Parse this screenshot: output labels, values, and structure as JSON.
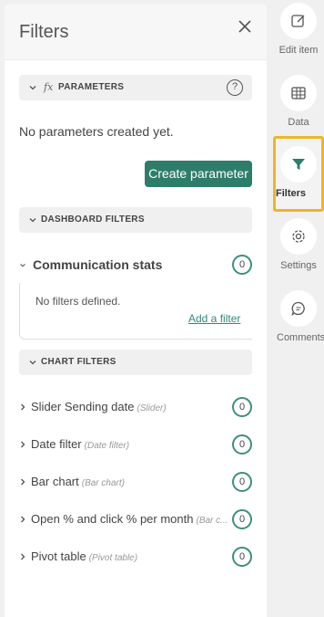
{
  "panel": {
    "title": "Filters"
  },
  "parameters": {
    "section_label": "PARAMETERS",
    "fx_label": "fx",
    "help_label": "?",
    "empty_text": "No parameters created yet.",
    "create_button": "Create parameter"
  },
  "dashboard_filters": {
    "section_label": "DASHBOARD FILTERS",
    "group_name": "Communication stats",
    "group_count": "0",
    "no_filters": "No filters defined.",
    "add_filter": "Add a filter"
  },
  "chart_filters": {
    "section_label": "CHART FILTERS",
    "items": [
      {
        "name": "Slider Sending date",
        "type": "(Slider)",
        "count": "0"
      },
      {
        "name": "Date filter",
        "type": "(Date filter)",
        "count": "0"
      },
      {
        "name": "Bar chart",
        "type": "(Bar chart)",
        "count": "0"
      },
      {
        "name": "Open % and click % per month",
        "type": "(Bar c...",
        "count": "0"
      },
      {
        "name": "Pivot table",
        "type": "(Pivot table)",
        "count": "0"
      }
    ]
  },
  "rail": {
    "edit_item": "Edit item",
    "data": "Data",
    "filters": "Filters",
    "settings": "Settings",
    "comments": "Comments"
  },
  "colors": {
    "accent": "#2e7d6b",
    "badge_border": "#3d8f7c",
    "highlight": "#f0b429"
  }
}
